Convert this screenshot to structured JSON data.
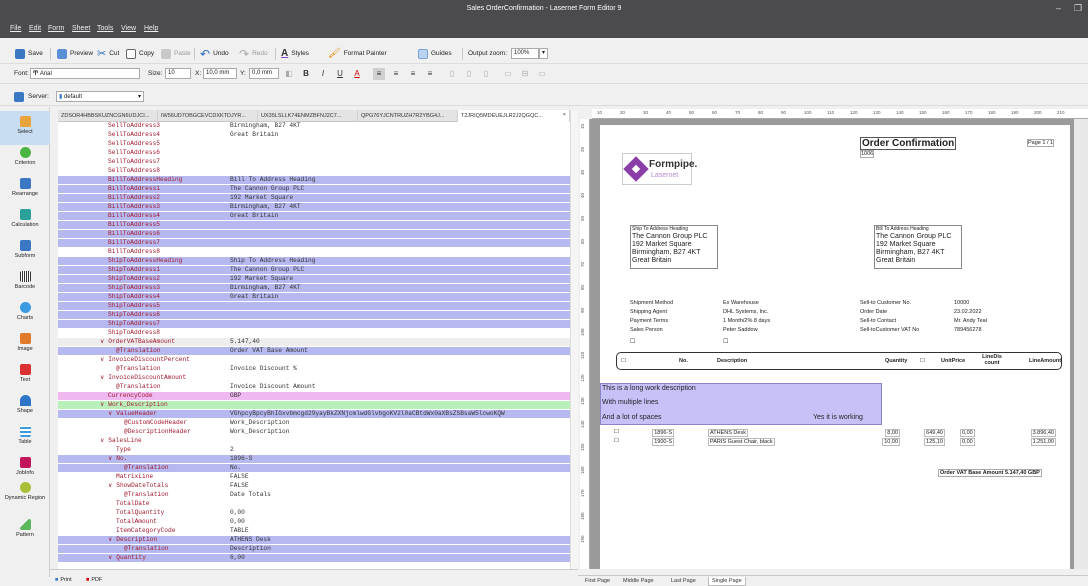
{
  "window": {
    "title": "Sales OrderConfirmation - Lasernet Form Editor 9"
  },
  "menu": [
    "File",
    "Edit",
    "Form",
    "Sheet",
    "Tools",
    "View",
    "Help"
  ],
  "toolbar1": {
    "save": "Save",
    "preview": "Preview",
    "cut": "Cut",
    "copy": "Copy",
    "paste": "Paste",
    "undo": "Undo",
    "redo": "Redo",
    "styles": "Styles",
    "format_painter": "Format Painter",
    "guides": "Guides",
    "output_zoom_label": "Output zoom:",
    "output_zoom": "100%"
  },
  "toolbar2": {
    "font_label": "Font:",
    "font": "Arial",
    "size_label": "Size:",
    "size": "10",
    "x_label": "X:",
    "x": "10,0 mm",
    "y_label": "Y:",
    "y": "0,0 mm"
  },
  "toolbar3": {
    "server_label": "Server:",
    "server": "default"
  },
  "tools": [
    "Select",
    "Criterion",
    "Rearrange",
    "Calculation",
    "Subform",
    "Barcode",
    "Charts",
    "Image",
    "Text",
    "Shape",
    "Table",
    "JobInfo",
    "Dynamic Region",
    "Pattern"
  ],
  "tabs": [
    "ZDSOR4HBBSKUZNCGN6UDJCI...",
    "IW56UD7OBGCEVCDXKTDJYR...",
    "UX35LSLLK74ENMZBFNJ2C7...",
    "QPG76YJCNTRUZH7R2YBG4J...",
    "T2JRIQ5MDEUEJLR2J2QGQC..."
  ],
  "tree_rows": [
    {
      "k": "SellToAddress3",
      "v": "Birmingham, B27 4KT",
      "c": "",
      "i": 40
    },
    {
      "k": "SellToAddress4",
      "v": "Great Britain",
      "c": "",
      "i": 40
    },
    {
      "k": "SellToAddress5",
      "v": "",
      "c": "",
      "i": 40
    },
    {
      "k": "SellToAddress6",
      "v": "",
      "c": "",
      "i": 40
    },
    {
      "k": "SellToAddress7",
      "v": "",
      "c": "",
      "i": 40
    },
    {
      "k": "SellToAddress8",
      "v": "",
      "c": "",
      "i": 40
    },
    {
      "k": "BillToAddressHeading",
      "v": "Bill To Address Heading",
      "c": "blue",
      "i": 40
    },
    {
      "k": "BillToAddress1",
      "v": "The Cannon Group PLC",
      "c": "blue",
      "i": 40
    },
    {
      "k": "BillToAddress2",
      "v": "192 Market Square",
      "c": "blue",
      "i": 40
    },
    {
      "k": "BillToAddress3",
      "v": "Birmingham, B27 4KT",
      "c": "blue",
      "i": 40
    },
    {
      "k": "BillToAddress4",
      "v": "Great Britain",
      "c": "blue",
      "i": 40
    },
    {
      "k": "BillToAddress5",
      "v": "",
      "c": "blue",
      "i": 40
    },
    {
      "k": "BillToAddress6",
      "v": "",
      "c": "blue",
      "i": 40
    },
    {
      "k": "BillToAddress7",
      "v": "",
      "c": "blue",
      "i": 40
    },
    {
      "k": "BillToAddress8",
      "v": "",
      "c": "",
      "i": 40
    },
    {
      "k": "ShipToAddressHeading",
      "v": "Ship To Address Heading",
      "c": "blue",
      "i": 40
    },
    {
      "k": "ShipToAddress1",
      "v": "The Cannon Group PLC",
      "c": "blue",
      "i": 40
    },
    {
      "k": "ShipToAddress2",
      "v": "192 Market Square",
      "c": "blue",
      "i": 40
    },
    {
      "k": "ShipToAddress3",
      "v": "Birmingham, B27 4KT",
      "c": "blue",
      "i": 40
    },
    {
      "k": "ShipToAddress4",
      "v": "Great Britain",
      "c": "blue",
      "i": 40
    },
    {
      "k": "ShipToAddress5",
      "v": "",
      "c": "blue",
      "i": 40
    },
    {
      "k": "ShipToAddress6",
      "v": "",
      "c": "blue",
      "i": 40
    },
    {
      "k": "ShipToAddress7",
      "v": "",
      "c": "blue",
      "i": 40
    },
    {
      "k": "ShipToAddress8",
      "v": "",
      "c": "",
      "i": 40
    },
    {
      "k": "∨ OrderVATBaseAmount",
      "v": "5.147,40",
      "c": "gray",
      "i": 32
    },
    {
      "k": "@Translation",
      "v": "Order VAT Base Amount",
      "c": "blue",
      "i": 48
    },
    {
      "k": "∨ InvoiceDiscountPercent",
      "v": "",
      "c": "",
      "i": 32
    },
    {
      "k": "@Translation",
      "v": "Invoice Discount %",
      "c": "",
      "i": 48
    },
    {
      "k": "∨ InvoiceDiscountAmount",
      "v": "",
      "c": "",
      "i": 32
    },
    {
      "k": "@Translation",
      "v": "Invoice Discount Amount",
      "c": "",
      "i": 48
    },
    {
      "k": "CurrencyCode",
      "v": "GBP",
      "c": "pink",
      "i": 40
    },
    {
      "k": "∨ Work_Description",
      "v": "",
      "c": "green",
      "i": 32
    },
    {
      "k": "∨ ValueHeader",
      "v": "VGhpcyBpcyBhIGxvbmcgd29yayBkZXNjcmlwdGlvbgoKV2l0aCBtdWx0aXBsZSBsaW5lcwoKQW",
      "c": "blue",
      "i": 40
    },
    {
      "k": "@CustomCodeHeader",
      "v": "Work_Description",
      "c": "",
      "i": 56
    },
    {
      "k": "@DescriptionHeader",
      "v": "Work_Description",
      "c": "",
      "i": 56
    },
    {
      "k": "∨ SalesLine",
      "v": "",
      "c": "",
      "i": 32
    },
    {
      "k": "Type",
      "v": "2",
      "c": "",
      "i": 48
    },
    {
      "k": "∨ No.",
      "v": "1896-S",
      "c": "blue",
      "i": 40
    },
    {
      "k": "@Translation",
      "v": "No.",
      "c": "blue",
      "i": 56
    },
    {
      "k": "MatrixLine",
      "v": "FALSE",
      "c": "",
      "i": 48
    },
    {
      "k": "∨ ShowDateTotals",
      "v": "FALSE",
      "c": "",
      "i": 40
    },
    {
      "k": "@Translation",
      "v": "Date Totals",
      "c": "",
      "i": 56
    },
    {
      "k": "TotalDate",
      "v": "",
      "c": "",
      "i": 48
    },
    {
      "k": "TotalQuantity",
      "v": "0,00",
      "c": "",
      "i": 48
    },
    {
      "k": "TotalAmount",
      "v": "0,00",
      "c": "",
      "i": 48
    },
    {
      "k": "ItemCategoryCode",
      "v": "TABLE",
      "c": "",
      "i": 48
    },
    {
      "k": "∨ Description",
      "v": "ATHENS Desk",
      "c": "blue",
      "i": 40
    },
    {
      "k": "@Translation",
      "v": "Description",
      "c": "blue",
      "i": 56
    },
    {
      "k": "∨ Quantity",
      "v": "6,00",
      "c": "blue",
      "i": 40
    }
  ],
  "bottom_tabs": {
    "print": "Print",
    "pdf": "PDF"
  },
  "page_tabs": [
    "First Page",
    "Middle Page",
    "Last Page",
    "Single Page"
  ],
  "ruler": [
    "10",
    "20",
    "30",
    "40",
    "50",
    "60",
    "70",
    "80",
    "90",
    "100",
    "110",
    "120",
    "130",
    "140",
    "150",
    "160",
    "170",
    "180",
    "190",
    "200",
    "210"
  ],
  "ruler_left": [
    "10",
    "20",
    "30",
    "40",
    "50",
    "60",
    "70",
    "80",
    "90",
    "100",
    "110",
    "120",
    "130",
    "140",
    "150",
    "160",
    "170",
    "180",
    "190"
  ],
  "doc": {
    "heading": "Order Confirmation",
    "order_no": "1006",
    "page": "Page 1 / 1",
    "logo_main": "Formpipe.",
    "logo_sub": "Lasernet",
    "ship_heading": "Ship To Address Heading",
    "ship_lines": [
      "The Cannon Group PLC",
      "192 Market Square",
      "Birmingham, B27 4KT",
      "Great Britain"
    ],
    "bill_heading": "Bill To Address Heading",
    "bill_lines": [
      "The Cannon Group PLC",
      "192 Market Square",
      "Birmingham, B27 4KT",
      "Great Britain"
    ],
    "info_left_labels": [
      "Shipment Method",
      "Shipping Agent",
      "Payment Terms",
      "Sales Person"
    ],
    "info_left_values": [
      "Ex Warehouse",
      "DHL Systems, Inc.",
      "1 Month/2% 8 days",
      "Peter Saddow"
    ],
    "info_right_labels": [
      "Sell-to Customer No.",
      "Order Date",
      "Sell-to Contact",
      "Sell-toCustomer VAT No"
    ],
    "info_right_values": [
      "10000",
      "23.02.2022",
      "Mr. Andy Teal",
      "789456278"
    ],
    "col_no": "No.",
    "col_desc": "Description",
    "col_qty": "Quantity",
    "col_price": "UnitPrice",
    "col_disc": "LineDis count",
    "col_amount": "LineAmount",
    "work_lines": [
      "This is a long work description",
      "With multiple lines",
      "And a lot of spaces",
      "Yes it is working"
    ],
    "lines": [
      {
        "no": "1896-S",
        "desc": "ATHENS Desk",
        "qty": "8,00",
        "price": "649,40",
        "disc": "0,00",
        "amount": "3.896,40"
      },
      {
        "no": "1900-S",
        "desc": "PARIS Guest Chair, black",
        "qty": "10,00",
        "price": "125,10",
        "disc": "0,00",
        "amount": "1.251,00"
      }
    ],
    "vat_label": "Order VAT Base Amount",
    "vat_value": "5.147,40 GBP"
  }
}
